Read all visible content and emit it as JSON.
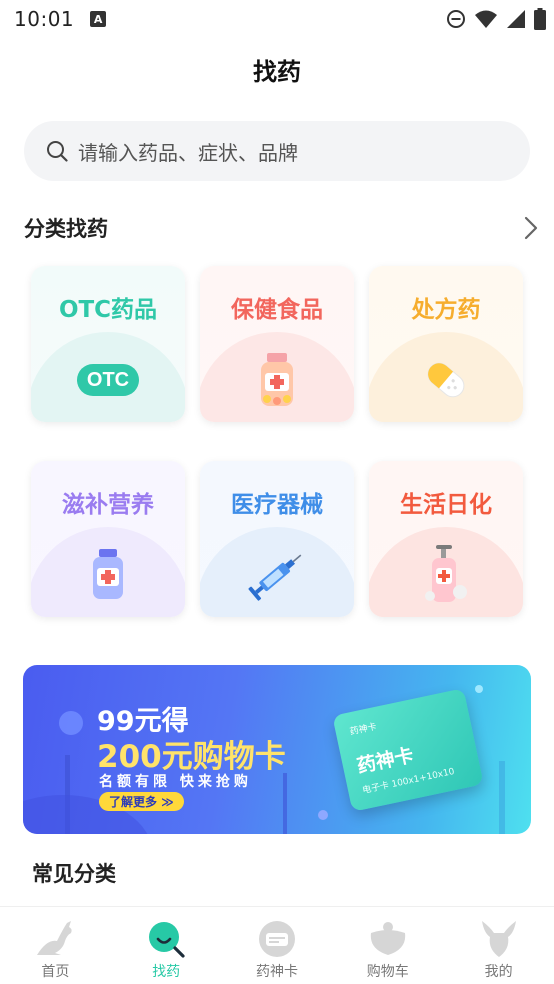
{
  "status_bar": {
    "time": "10:01",
    "a_badge": "A"
  },
  "header": {
    "title": "找药"
  },
  "search": {
    "placeholder": "请输入药品、症状、品牌"
  },
  "category_section": {
    "title": "分类找药"
  },
  "categories": [
    {
      "label": "OTC药品",
      "color": "#2fc8a8",
      "icon": "otc-badge-icon",
      "art_text": "OTC"
    },
    {
      "label": "保健食品",
      "color": "#f2665d",
      "icon": "supplement-bottle-icon"
    },
    {
      "label": "处方药",
      "color": "#f6ad2e",
      "icon": "capsule-icon"
    },
    {
      "label": "滋补营养",
      "color": "#9a7cf0",
      "icon": "nutrition-bottle-icon"
    },
    {
      "label": "医疗器械",
      "color": "#3f8ee8",
      "icon": "syringe-icon"
    },
    {
      "label": "生活日化",
      "color": "#f25a3e",
      "icon": "pump-bottle-icon"
    }
  ],
  "banner": {
    "line1": "99元得",
    "line2": "200元购物卡",
    "line3": "名额有限 快来抢购",
    "button": "了解更多 ≫",
    "card_title": "药神卡",
    "card_brand": "药神卡",
    "card_sub": "电子卡 100x1+10x10"
  },
  "common_section": {
    "title": "常见分类"
  },
  "tabs": [
    {
      "label": "首页",
      "icon": "kangaroo-home-icon",
      "active": false
    },
    {
      "label": "找药",
      "icon": "search-find-icon",
      "active": true
    },
    {
      "label": "药神卡",
      "icon": "medicine-card-icon",
      "active": false
    },
    {
      "label": "购物车",
      "icon": "cart-icon",
      "active": false
    },
    {
      "label": "我的",
      "icon": "profile-icon",
      "active": false
    }
  ],
  "colors": {
    "accent": "#27c9a6",
    "tab_inactive": "#d6d6d6"
  }
}
